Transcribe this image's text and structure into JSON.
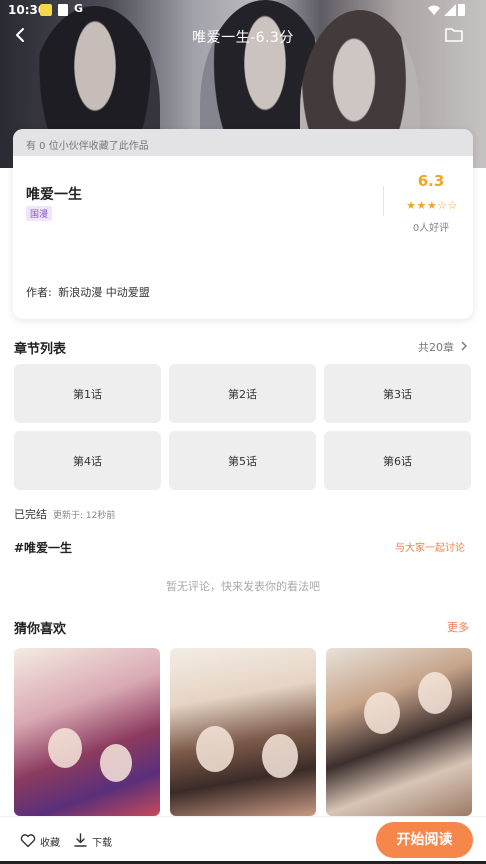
{
  "status_bar": {
    "time": "10:30",
    "g_icon": "G"
  },
  "header": {
    "title": "唯爱一生-6.3分"
  },
  "info_card": {
    "collect_note": "有 0 位小伙伴收藏了此作品",
    "name": "唯爱一生",
    "tag": "国漫",
    "score": "6.3",
    "stars": "★★★☆☆",
    "likes": "0人好评",
    "author_label": "作者:",
    "author_value": "新浪动漫 中动爱盟"
  },
  "chapters": {
    "title": "章节列表",
    "total": "共20章",
    "items": [
      "第1话",
      "第2话",
      "第3话",
      "第4话",
      "第5话",
      "第6话"
    ]
  },
  "status_line": {
    "state": "已完结",
    "updated": "更新于: 12秒前"
  },
  "discussion": {
    "hashtag": "#唯爱一生",
    "link": "与大家一起讨论",
    "empty": "暂无评论，快来发表你的看法吧"
  },
  "recommend": {
    "title": "猜你喜欢",
    "more": "更多"
  },
  "bottom_bar": {
    "favorite": "收藏",
    "download": "下载",
    "read": "开始阅读"
  },
  "colors": {
    "accent": "#f6874b",
    "score": "#f2a428",
    "tag": "#8a58d6"
  }
}
